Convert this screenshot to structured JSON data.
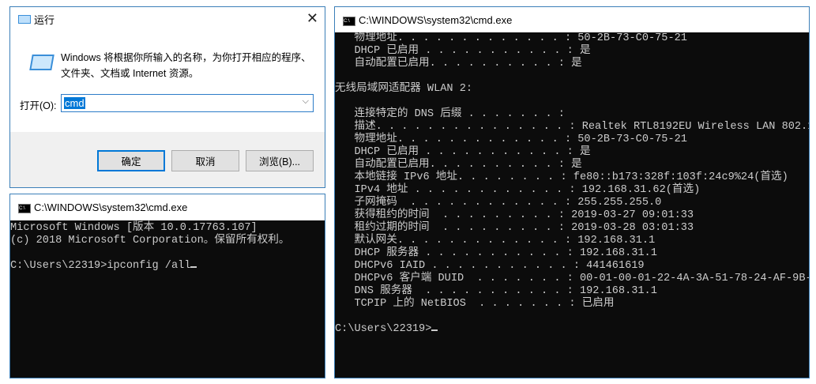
{
  "run_dialog": {
    "title": "运行",
    "close": "✕",
    "description": "Windows 将根据你所输入的名称，为你打开相应的程序、文件夹、文档或 Internet 资源。",
    "open_label": "打开(O):",
    "input_value": "cmd",
    "ok": "确定",
    "cancel": "取消",
    "browse": "浏览(B)..."
  },
  "cmd_small": {
    "title": "C:\\WINDOWS\\system32\\cmd.exe",
    "lines": [
      "Microsoft Windows [版本 10.0.17763.107]",
      "(c) 2018 Microsoft Corporation。保留所有权利。",
      "",
      "C:\\Users\\22319>ipconfig /all"
    ]
  },
  "cmd_large": {
    "title": "C:\\WINDOWS\\system32\\cmd.exe",
    "lines": [
      "   物理地址. . . . . . . . . . . . . : 50-2B-73-C0-75-21",
      "   DHCP 已启用 . . . . . . . . . . . : 是",
      "   自动配置已启用. . . . . . . . . . : 是",
      "",
      "无线局域网适配器 WLAN 2:",
      "",
      "   连接特定的 DNS 后缀 . . . . . . . :",
      "   描述. . . . . . . . . . . . . . . : Realtek RTL8192EU Wireless LAN 802.1",
      "   物理地址. . . . . . . . . . . . . : 50-2B-73-C0-75-21",
      "   DHCP 已启用 . . . . . . . . . . . : 是",
      "   自动配置已启用. . . . . . . . . . : 是",
      "   本地链接 IPv6 地址. . . . . . . . : fe80::b173:328f:103f:24c9%24(首选)",
      "   IPv4 地址 . . . . . . . . . . . . : 192.168.31.62(首选)",
      "   子网掩码  . . . . . . . . . . . . : 255.255.255.0",
      "   获得租约的时间  . . . . . . . . . : 2019-03-27 09:01:33",
      "   租约过期的时间  . . . . . . . . . : 2019-03-28 03:01:33",
      "   默认网关. . . . . . . . . . . . . : 192.168.31.1",
      "   DHCP 服务器 . . . . . . . . . . . : 192.168.31.1",
      "   DHCPv6 IAID . . . . . . . . . . . : 441461619",
      "   DHCPv6 客户端 DUID  . . . . . . . : 00-01-00-01-22-4A-3A-51-78-24-AF-9B-",
      "   DNS 服务器  . . . . . . . . . . . : 192.168.31.1",
      "   TCPIP 上的 NetBIOS  . . . . . . . : 已启用",
      "",
      "C:\\Users\\22319>"
    ]
  }
}
